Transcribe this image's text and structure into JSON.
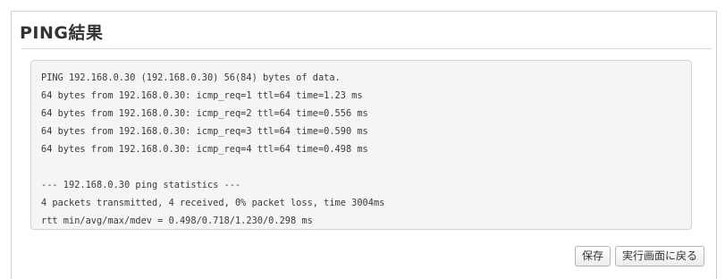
{
  "panel": {
    "title": "PING結果"
  },
  "ping": {
    "header": "PING 192.168.0.30 (192.168.0.30) 56(84) bytes of data.",
    "replies": [
      "64 bytes from 192.168.0.30: icmp_req=1 ttl=64 time=1.23 ms",
      "64 bytes from 192.168.0.30: icmp_req=2 ttl=64 time=0.556 ms",
      "64 bytes from 192.168.0.30: icmp_req=3 ttl=64 time=0.590 ms",
      "64 bytes from 192.168.0.30: icmp_req=4 ttl=64 time=0.498 ms"
    ],
    "stats_header": "--- 192.168.0.30 ping statistics ---",
    "stats_summary": "4 packets transmitted, 4 received, 0% packet loss, time 3004ms",
    "stats_rtt": "rtt min/avg/max/mdev = 0.498/0.718/1.230/0.298 ms"
  },
  "actions": {
    "save_label": "保存",
    "back_label": "実行画面に戻る"
  }
}
